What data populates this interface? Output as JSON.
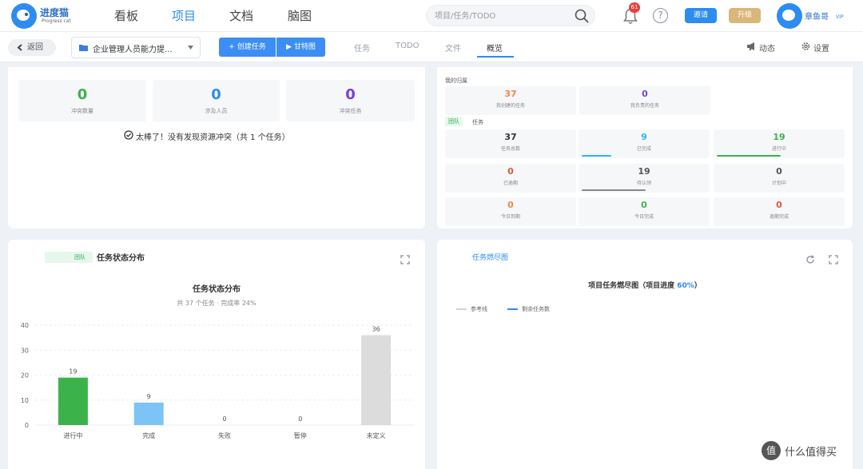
{
  "topbar": {
    "logo": {
      "name": "进度猫",
      "subtitle": "Progress cat"
    },
    "nav": [
      {
        "label": "看板",
        "active": false
      },
      {
        "label": "项目",
        "active": true
      },
      {
        "label": "文档",
        "active": false
      },
      {
        "label": "脑图",
        "active": false
      }
    ],
    "search_placeholder": "项目/任务/TODO",
    "notification_count": "61",
    "help_symbol": "?",
    "invite_label": "邀请",
    "upgrade_label": "升级",
    "username": "章鱼哥",
    "vip_label": "VIP"
  },
  "subbar": {
    "back_label": "返回",
    "project_name": "企业管理人员能力提...",
    "create_task_label": "+ 创建任务",
    "gantt_label": "▶ 甘特图",
    "tabs": [
      {
        "label": "任务",
        "active": false
      },
      {
        "label": "TODO",
        "active": false
      },
      {
        "label": "文件",
        "active": false
      },
      {
        "label": "概览",
        "active": true
      }
    ],
    "dynamic_label": "动态",
    "settings_label": "设置"
  },
  "conflict": {
    "stats": [
      {
        "value": "0",
        "label": "冲突数量",
        "color": "#3cb34a"
      },
      {
        "value": "0",
        "label": "涉及人员",
        "color": "#2d8cf0"
      },
      {
        "value": "0",
        "label": "冲突任务",
        "color": "#7a3fd9"
      }
    ],
    "message": "太棒了！没有发现资源冲突（共 1 个任务）"
  },
  "mine": {
    "section_label": "我的归属",
    "items": [
      {
        "value": "37",
        "label": "我创建的任务",
        "color": "#f0883e"
      },
      {
        "value": "0",
        "label": "我负责的任务",
        "color": "#7a3fd9"
      }
    ]
  },
  "team": {
    "tag": "团队",
    "section_label": "任务",
    "items": [
      {
        "value": "37",
        "label": "任务总数",
        "color": "#333333"
      },
      {
        "value": "9",
        "label": "已完成",
        "color": "#2db7e8",
        "progress": 0.24
      },
      {
        "value": "19",
        "label": "进行中",
        "color": "#3cb34a",
        "progress": 0.51
      },
      {
        "value": "0",
        "label": "已逾期",
        "color": "#e8533c"
      },
      {
        "value": "19",
        "label": "待认领",
        "color": "#555555",
        "progress": 0.51
      },
      {
        "value": "0",
        "label": "计划中",
        "color": "#555555"
      },
      {
        "value": "0",
        "label": "今日到期",
        "color": "#f0883e"
      },
      {
        "value": "0",
        "label": "今日完成",
        "color": "#3cb34a"
      },
      {
        "value": "0",
        "label": "逾期完成",
        "color": "#e8533c"
      }
    ]
  },
  "status_panel": {
    "tag": "团队",
    "title": "任务状态分布"
  },
  "burndown_panel": {
    "title": "任务燃尽图",
    "chart_title_prefix": "项目任务燃尽图（项目进度 ",
    "progress": "60%",
    "chart_title_suffix": "）",
    "legend": [
      {
        "label": "参考线",
        "color": "#d0d3d8"
      },
      {
        "label": "剩余任务数",
        "color": "#2d8cf0"
      }
    ]
  },
  "chart_data": {
    "type": "bar",
    "title": "任务状态分布",
    "subtitle": "共 37 个任务 · 完成率 24%",
    "categories": [
      "进行中",
      "完成",
      "失败",
      "暂停",
      "未定义"
    ],
    "values": [
      19,
      9,
      0,
      0,
      36
    ],
    "colors": [
      "#3cb34a",
      "#7cc4f5",
      "#cccccc",
      "#cccccc",
      "#dcdcdc"
    ],
    "yticks": [
      0,
      10,
      20,
      30,
      40
    ],
    "ylim": [
      0,
      40
    ],
    "grid": true
  },
  "watermark": {
    "symbol": "值",
    "text": "什么值得买"
  }
}
